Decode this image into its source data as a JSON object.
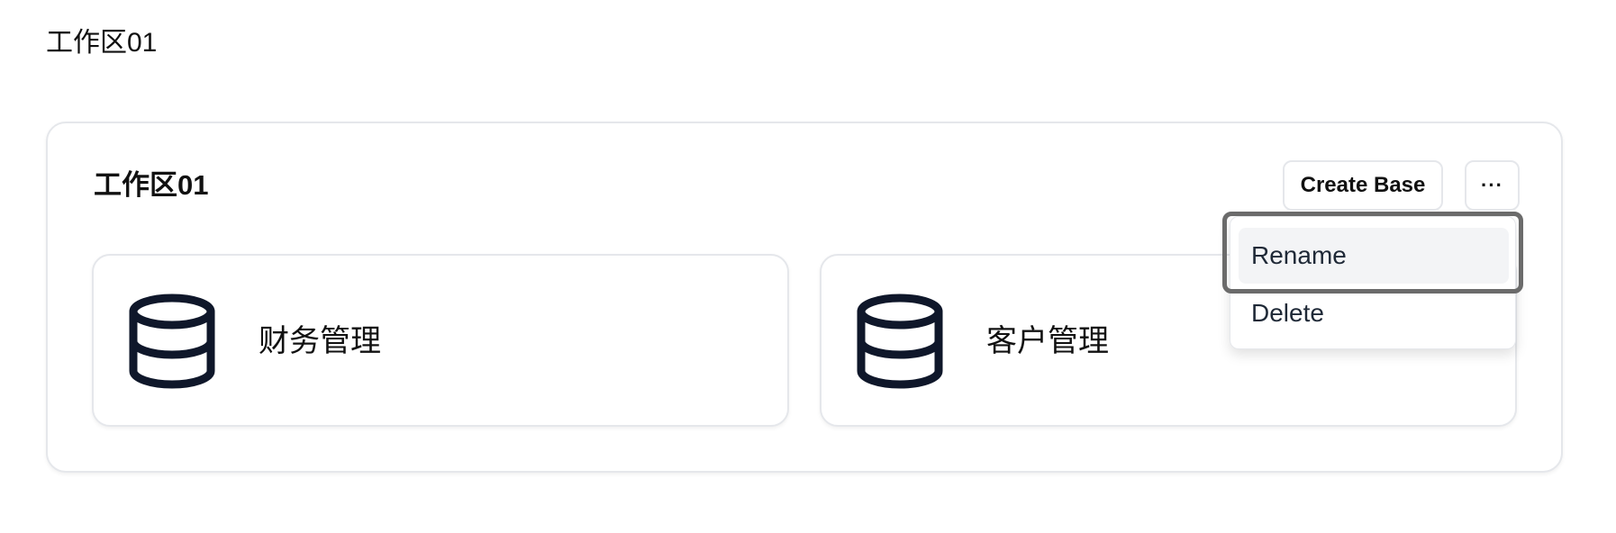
{
  "page": {
    "title": "工作区01"
  },
  "workspace": {
    "title": "工作区01",
    "create_base_label": "Create Base",
    "more_label": "···",
    "bases": [
      {
        "name": "财务管理",
        "icon": "database-icon"
      },
      {
        "name": "客户管理",
        "icon": "database-icon"
      }
    ]
  },
  "menu": {
    "items": [
      {
        "label": "Rename",
        "highlighted": true
      },
      {
        "label": "Delete",
        "highlighted": false
      }
    ]
  },
  "colors": {
    "border": "#e5e7eb",
    "text": "#111111",
    "hover_bg": "#f3f4f6",
    "focus_ring": "#6b6b6b",
    "icon": "#0f172a"
  }
}
